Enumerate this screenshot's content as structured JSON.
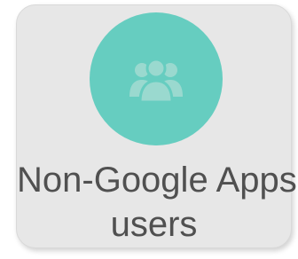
{
  "tile": {
    "label_line1": "Non-Google Apps",
    "label_line2": "users",
    "icon": "users-group-icon",
    "colors": {
      "card_background": "#e7e7e7",
      "circle": "#66cdc0",
      "icon": "#9ad9cf",
      "text": "#505050"
    }
  }
}
